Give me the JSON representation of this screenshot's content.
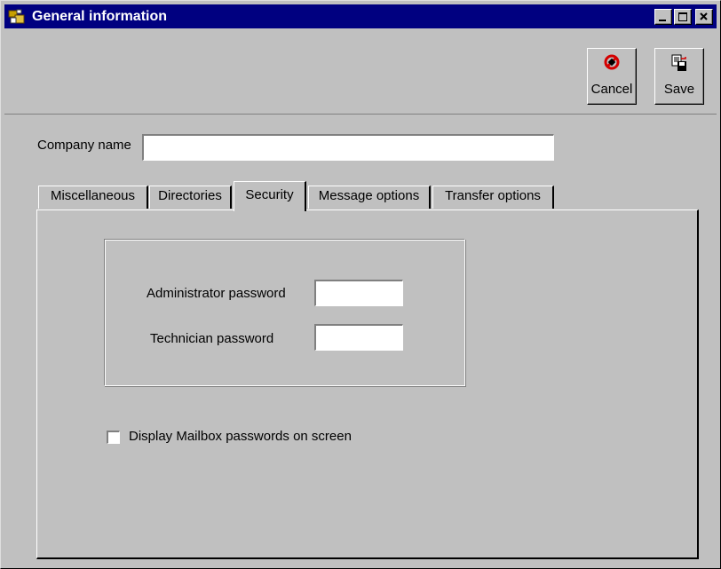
{
  "window": {
    "title": "General information",
    "controls": [
      "minimize-icon",
      "maximize-icon",
      "close-icon"
    ]
  },
  "toolbar": {
    "cancel_label": "Cancel",
    "save_label": "Save",
    "cancel_icon": "cancel-icon",
    "save_icon": "save-icon"
  },
  "company": {
    "label": "Company name",
    "value": ""
  },
  "tabs": [
    {
      "label": "Miscellaneous",
      "active": false
    },
    {
      "label": "Directories",
      "active": false
    },
    {
      "label": "Security",
      "active": true
    },
    {
      "label": "Message options",
      "active": false
    },
    {
      "label": "Transfer options",
      "active": false
    }
  ],
  "security": {
    "admin_password_label": "Administrator password",
    "admin_password_value": "",
    "tech_password_label": "Technician password",
    "tech_password_value": "",
    "display_passwords_label": "Display Mailbox passwords on screen",
    "display_passwords_checked": false
  },
  "colors": {
    "titlebar": "#000080",
    "face": "#c0c0c0",
    "cancel_icon": "#d40000"
  }
}
